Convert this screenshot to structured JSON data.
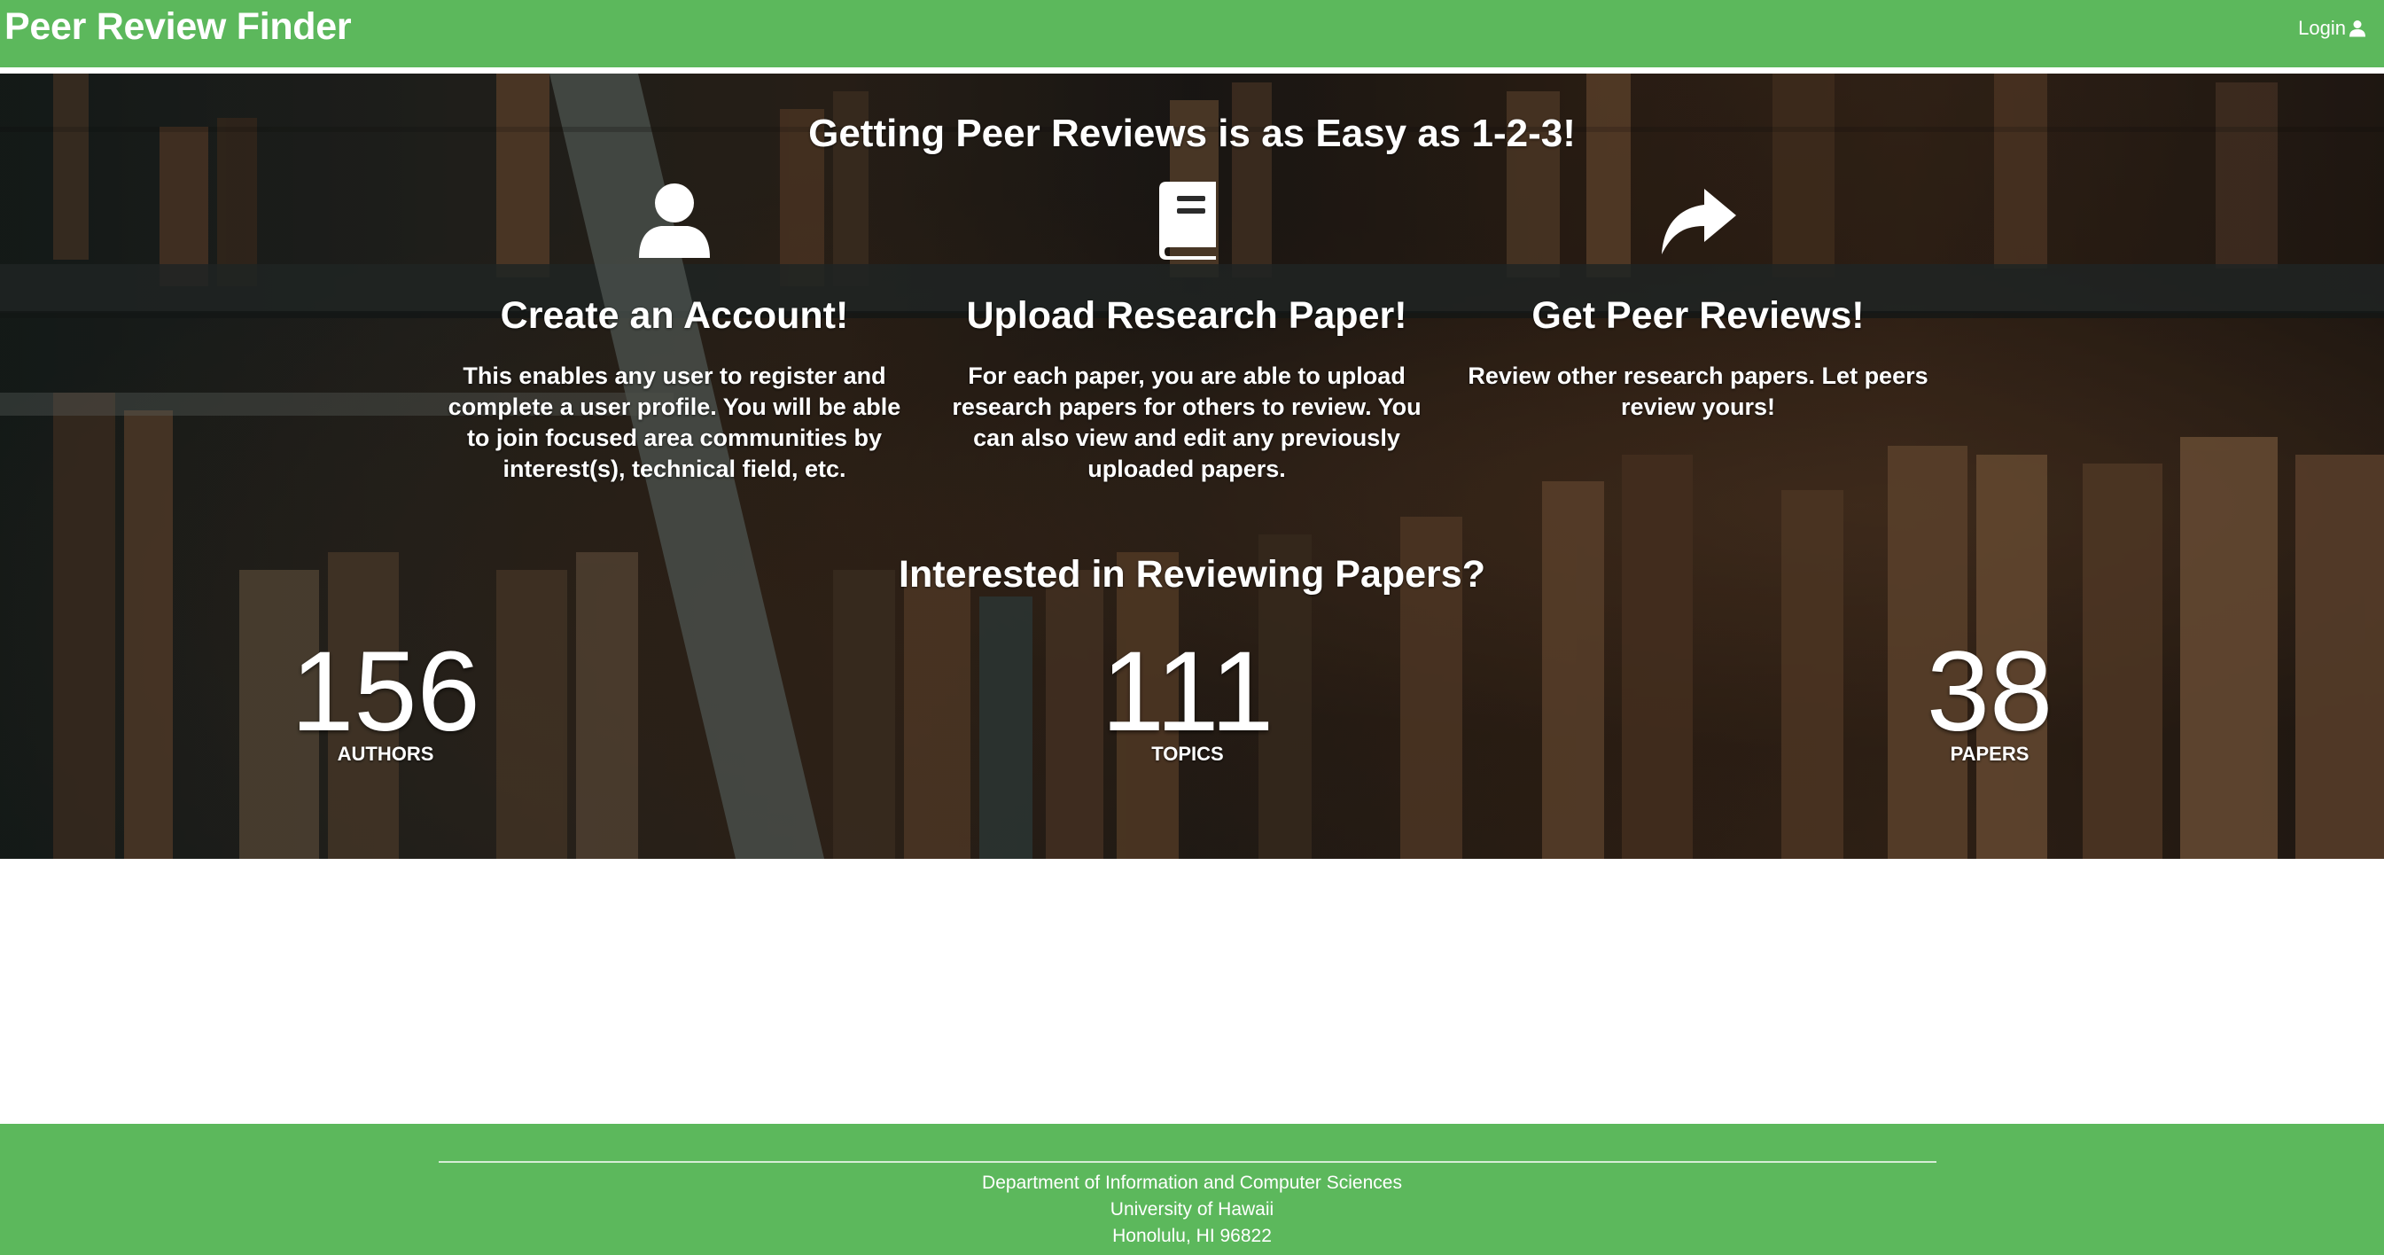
{
  "navbar": {
    "brand": "Peer Review Finder",
    "login_label": "Login",
    "login_icon": "user-icon",
    "color": "#5cb85c"
  },
  "hero": {
    "title": "Getting Peer Reviews is as Easy as 1-2-3!",
    "steps": [
      {
        "icon": "user-icon",
        "title": "Create an Account!",
        "description": "This enables any user to register and complete a user profile. You will be able to join focused area communities by interest(s), technical field, etc."
      },
      {
        "icon": "book-icon",
        "title": "Upload Research Paper!",
        "description": "For each paper, you are able to upload research papers for others to review. You can also view and edit any previously uploaded papers."
      },
      {
        "icon": "share-arrow-icon",
        "title": "Get Peer Reviews!",
        "description": "Review other research papers. Let peers review yours!"
      }
    ],
    "interest_title": "Interested in Reviewing Papers?",
    "stats": [
      {
        "value": "156",
        "label": "AUTHORS"
      },
      {
        "value": "111",
        "label": "TOPICS"
      },
      {
        "value": "38",
        "label": "PAPERS"
      }
    ]
  },
  "footer": {
    "lines": [
      "Department of Information and Computer Sciences",
      "University of Hawaii",
      "Honolulu, HI 96822"
    ],
    "color": "#5cb85c"
  }
}
